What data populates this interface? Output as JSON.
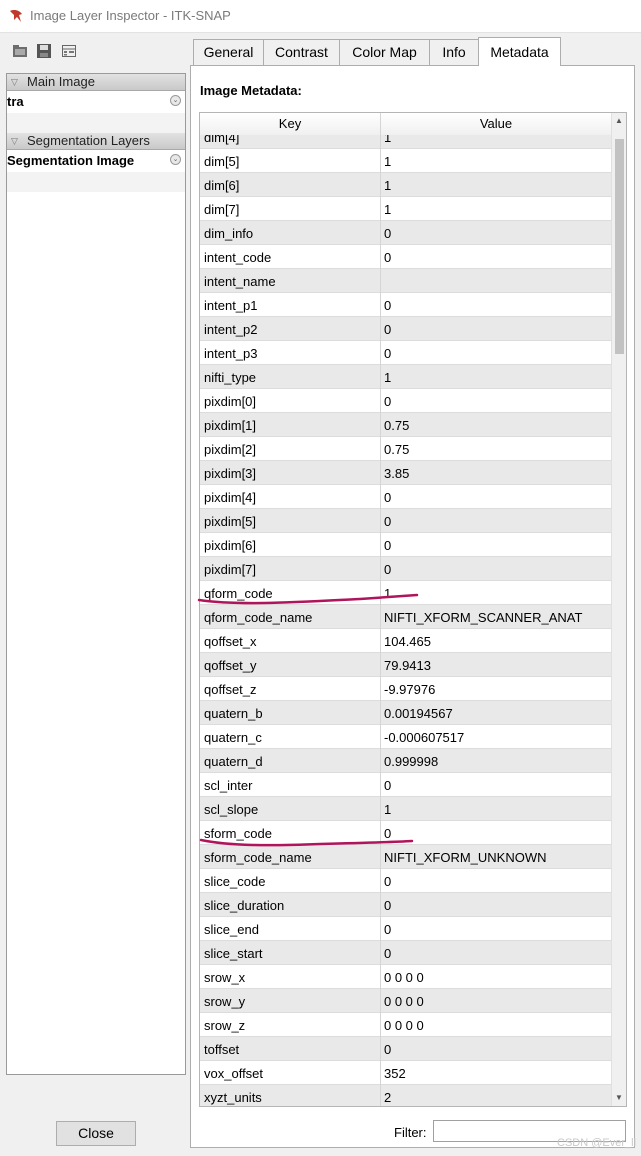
{
  "window": {
    "title": "Image Layer Inspector - ITK-SNAP",
    "app_icon": "itksnap-icon"
  },
  "toolbar": {
    "icons": [
      "open-icon",
      "save-icon",
      "layout-icon"
    ]
  },
  "left_panel": {
    "groups": [
      {
        "label": "Main Image",
        "layers": [
          "tra"
        ]
      },
      {
        "label": "Segmentation Layers",
        "layers": [
          "Segmentation Image"
        ]
      }
    ]
  },
  "tabs": [
    "General",
    "Contrast",
    "Color Map",
    "Info",
    "Metadata"
  ],
  "active_tab": "Metadata",
  "metadata": {
    "title": "Image Metadata:",
    "columns": [
      "Key",
      "Value"
    ],
    "rows": [
      [
        "dim[4]",
        "1"
      ],
      [
        "dim[5]",
        "1"
      ],
      [
        "dim[6]",
        "1"
      ],
      [
        "dim[7]",
        "1"
      ],
      [
        "dim_info",
        "0"
      ],
      [
        "intent_code",
        "0"
      ],
      [
        "intent_name",
        ""
      ],
      [
        "intent_p1",
        "0"
      ],
      [
        "intent_p2",
        "0"
      ],
      [
        "intent_p3",
        "0"
      ],
      [
        "nifti_type",
        "1"
      ],
      [
        "pixdim[0]",
        "0"
      ],
      [
        "pixdim[1]",
        "0.75"
      ],
      [
        "pixdim[2]",
        "0.75"
      ],
      [
        "pixdim[3]",
        "3.85"
      ],
      [
        "pixdim[4]",
        "0"
      ],
      [
        "pixdim[5]",
        "0"
      ],
      [
        "pixdim[6]",
        "0"
      ],
      [
        "pixdim[7]",
        "0"
      ],
      [
        "qform_code",
        "1"
      ],
      [
        "qform_code_name",
        "NIFTI_XFORM_SCANNER_ANAT"
      ],
      [
        "qoffset_x",
        "104.465"
      ],
      [
        "qoffset_y",
        "79.9413"
      ],
      [
        "qoffset_z",
        "-9.97976"
      ],
      [
        "quatern_b",
        "0.00194567"
      ],
      [
        "quatern_c",
        "-0.000607517"
      ],
      [
        "quatern_d",
        "0.999998"
      ],
      [
        "scl_inter",
        "0"
      ],
      [
        "scl_slope",
        "1"
      ],
      [
        "sform_code",
        "0"
      ],
      [
        "sform_code_name",
        "NIFTI_XFORM_UNKNOWN"
      ],
      [
        "slice_code",
        "0"
      ],
      [
        "slice_duration",
        "0"
      ],
      [
        "slice_end",
        "0"
      ],
      [
        "slice_start",
        "0"
      ],
      [
        "srow_x",
        "0 0 0 0"
      ],
      [
        "srow_y",
        "0 0 0 0"
      ],
      [
        "srow_z",
        "0 0 0 0"
      ],
      [
        "toffset",
        "0"
      ],
      [
        "vox_offset",
        "352"
      ],
      [
        "xyzt_units",
        "2"
      ]
    ]
  },
  "filter": {
    "label": "Filter:",
    "value": ""
  },
  "close_button": "Close",
  "watermark": "CSDN @Ever_ll",
  "colors": {
    "annotation_underline": "#b0145a"
  }
}
